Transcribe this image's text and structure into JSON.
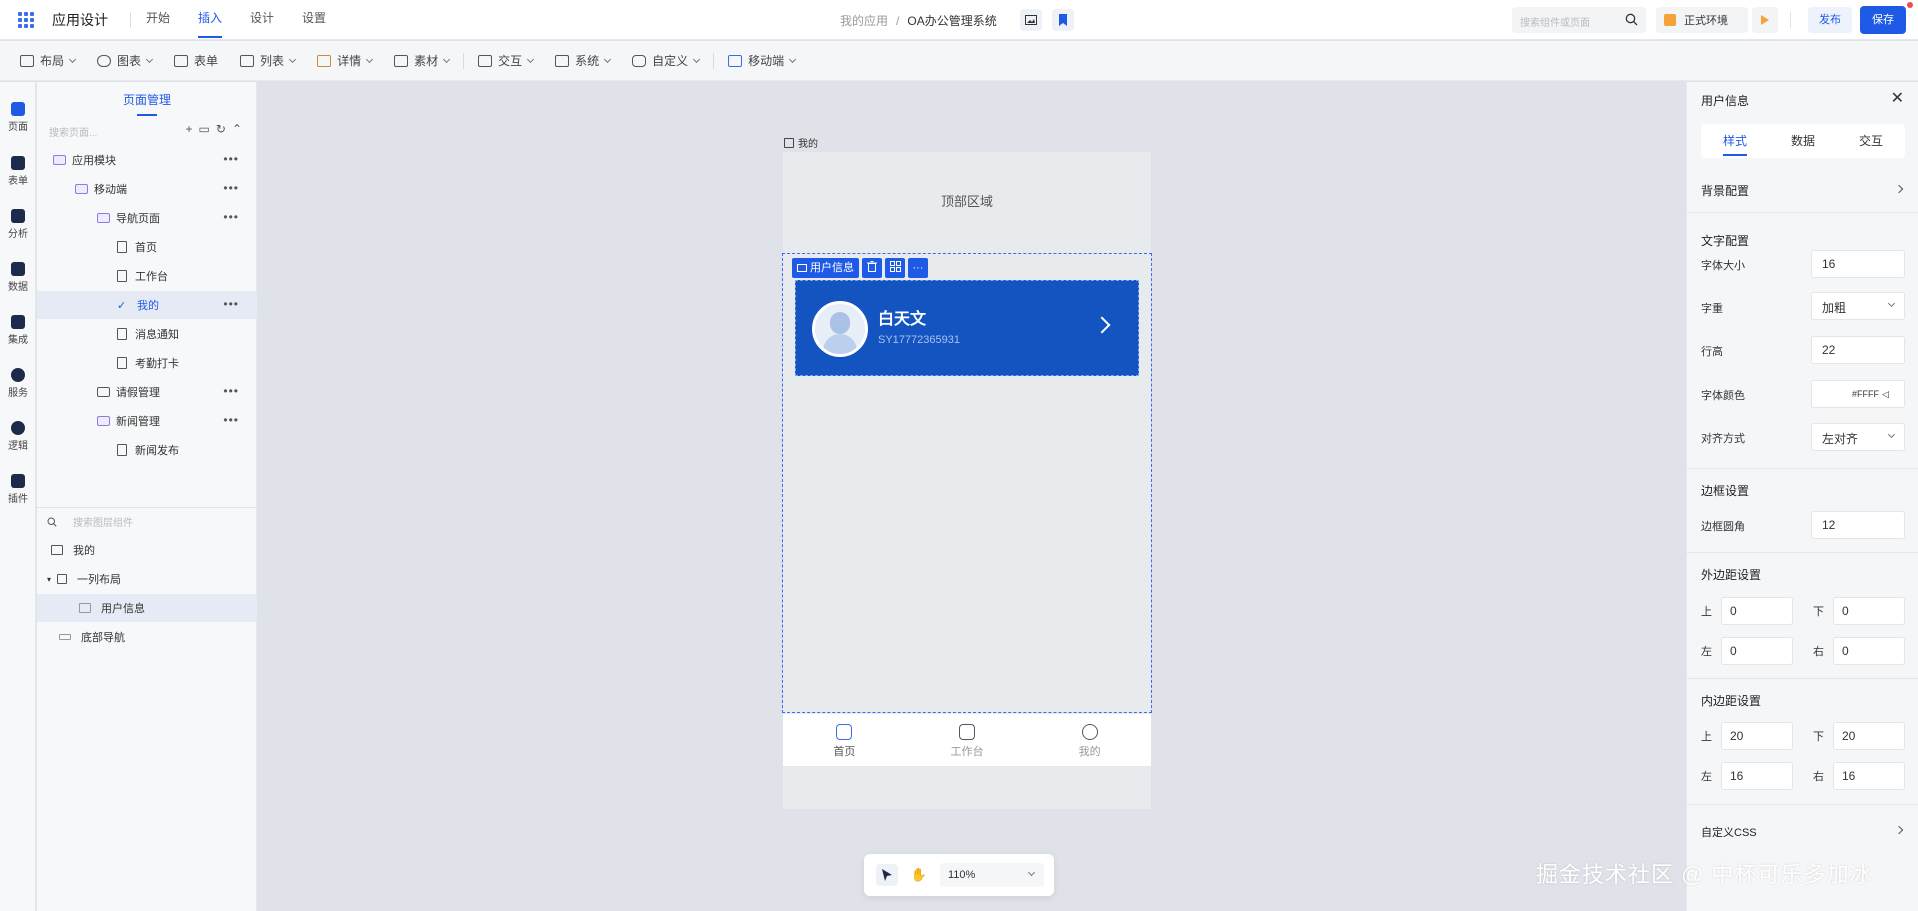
{
  "topbar": {
    "app_title": "应用设计",
    "tabs": [
      "开始",
      "插入",
      "设计",
      "设置"
    ],
    "active_tab": "插入",
    "breadcrumb_parent": "我的应用",
    "breadcrumb_sep": "/",
    "breadcrumb_current": "OA办公管理系统",
    "search_placeholder": "搜索组件或页面",
    "env_label": "正式环境",
    "publish_label": "发布",
    "save_label": "保存"
  },
  "toolbar": {
    "items": [
      "布局",
      "图表",
      "表单",
      "列表",
      "详情",
      "素材",
      "交互",
      "系统",
      "自定义",
      "移动端"
    ]
  },
  "rail": {
    "items": [
      "页面",
      "表单",
      "分析",
      "数据",
      "集成",
      "服务",
      "逻辑",
      "插件"
    ]
  },
  "page_manager": {
    "title": "页面管理",
    "search_placeholder": "搜索页面...",
    "tree": [
      {
        "label": "应用模块",
        "type": "folder",
        "dots": "•••"
      },
      {
        "label": "移动端",
        "type": "folder",
        "dots": "•••"
      },
      {
        "label": "导航页面",
        "type": "folder",
        "dots": "•••"
      },
      {
        "label": "首页",
        "type": "page"
      },
      {
        "label": "工作台",
        "type": "page"
      },
      {
        "label": "我的",
        "type": "selected",
        "dots": "•••"
      },
      {
        "label": "消息通知",
        "type": "page"
      },
      {
        "label": "考勤打卡",
        "type": "page"
      },
      {
        "label": "请假管理",
        "type": "folder-plain",
        "dots": "•••"
      },
      {
        "label": "新闻管理",
        "type": "folder",
        "dots": "•••"
      },
      {
        "label": "新闻发布",
        "type": "page"
      }
    ],
    "layer_search_placeholder": "搜索图层组件",
    "layers": [
      {
        "label": "我的"
      },
      {
        "label": "一列布局"
      },
      {
        "label": "用户信息"
      },
      {
        "label": "底部导航"
      }
    ]
  },
  "canvas": {
    "page_label": "我的",
    "top_area": "顶部区域",
    "selected_tag": "用户信息",
    "user": {
      "name": "白天文",
      "id": "SY17772365931"
    },
    "tabbar": [
      "首页",
      "工作台",
      "我的"
    ],
    "zoom": "110%"
  },
  "right_panel": {
    "title": "用户信息",
    "tabs": [
      "样式",
      "数据",
      "交互"
    ],
    "active_tab": "样式",
    "bg_config": "背景配置",
    "text_config": "文字配置",
    "font_size_label": "字体大小",
    "font_size": "16",
    "font_weight_label": "字重",
    "font_weight": "加粗",
    "line_height_label": "行高",
    "line_height": "22",
    "font_color_label": "字体颜色",
    "font_color": "#FFFF",
    "align_label": "对齐方式",
    "align": "左对齐",
    "border_section": "边框设置",
    "radius_label": "边框圆角",
    "radius": "12",
    "margin_section": "外边距设置",
    "margin": {
      "top": "0",
      "bottom": "0",
      "left": "0",
      "right": "0"
    },
    "padding_section": "内边距设置",
    "padding": {
      "top": "20",
      "bottom": "20",
      "left": "16",
      "right": "16"
    },
    "dir": {
      "top": "上",
      "bottom": "下",
      "left": "左",
      "right": "右"
    },
    "custom_css": "自定义CSS"
  },
  "watermark": "掘金技术社区 @ 中杯可乐多加冰",
  "colors": {
    "accent": "#1f5ae6",
    "card": "#1454c0"
  }
}
